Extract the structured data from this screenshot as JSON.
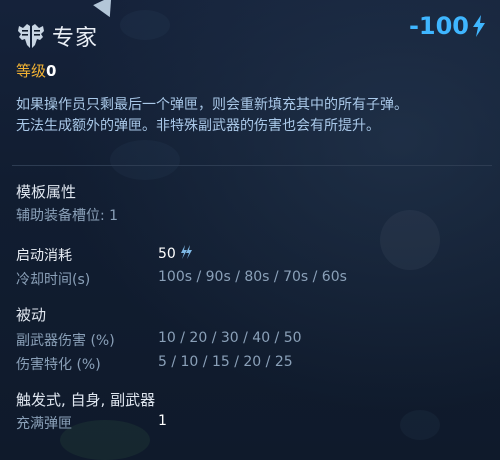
{
  "header": {
    "title": "专家",
    "icon": "wings-emblem-icon",
    "cost": "-100",
    "cost_icon": "energy-bolt-icon",
    "cost_color": "#3fb6ff"
  },
  "level": {
    "label": "等级",
    "value": "0",
    "label_color": "#f2b233"
  },
  "description": [
    "如果操作员只剩最后一个弹匣，则会重新填充其中的所有子弹。",
    "无法生成额外的弹匣。非特殊副武器的伤害也会有所提升。"
  ],
  "template": {
    "title": "模板属性",
    "slot": "辅助装备槽位: 1"
  },
  "activation": {
    "label": "启动消耗",
    "cost": "50",
    "cost_icon": "energy-double-bolt-icon",
    "cooldown_label": "冷却时间(s)",
    "cooldown_values": "100s / 90s / 80s / 70s / 60s"
  },
  "passive": {
    "title": "被动",
    "rows": [
      {
        "label": "副武器伤害 (%)",
        "value": "10 / 20 / 30 / 40 / 50"
      },
      {
        "label": "伤害特化 (%)",
        "value": "5 / 10 / 15 / 20 / 25"
      }
    ]
  },
  "trigger": {
    "title": "触发式, 自身, 副武器",
    "label": "充满弹匣",
    "value": "1"
  }
}
